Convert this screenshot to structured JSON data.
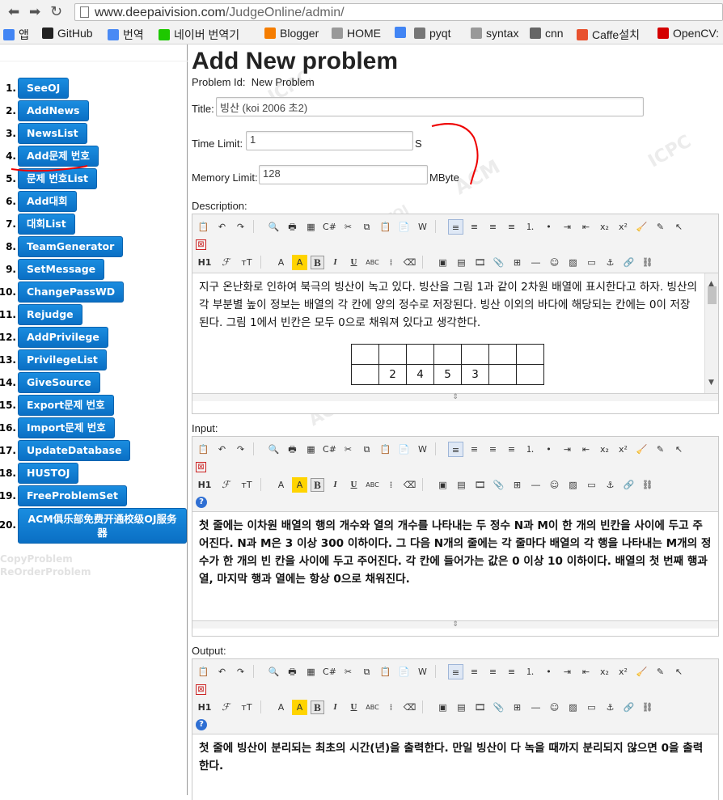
{
  "browser": {
    "url_host": "www.deepaivision.com",
    "url_path": "/JudgeOnline/admin/",
    "bookmarks": [
      {
        "label": "앱",
        "icon": "apps-grid-icon",
        "color": "#4285f4"
      },
      {
        "label": "GitHub",
        "icon": "github-icon",
        "color": "#222222"
      },
      {
        "label": "번역",
        "icon": "translate-icon",
        "color": "#4a8af4"
      },
      {
        "label": "네이버 번역기",
        "icon": "naver-icon",
        "color": "#1ec800"
      },
      {
        "label": "Blogger",
        "icon": "blogger-icon",
        "color": "#f57d00"
      },
      {
        "label": "HOME",
        "icon": "page-icon",
        "color": "#999999"
      },
      {
        "label": "",
        "icon": "google-icon",
        "color": "#4285f4"
      },
      {
        "label": "pyqt",
        "icon": "wiki-icon",
        "color": "#777777"
      },
      {
        "label": "syntax",
        "icon": "page-icon",
        "color": "#999999"
      },
      {
        "label": "cnn",
        "icon": "cnn-icon",
        "color": "#666666"
      },
      {
        "label": "Caffe설치",
        "icon": "caffe-icon",
        "color": "#e8522f"
      },
      {
        "label": "OpenCV:",
        "icon": "opencv-icon",
        "color": "#d40000"
      }
    ]
  },
  "sidebar": {
    "items": [
      {
        "num": "1.",
        "label": "SeeOJ"
      },
      {
        "num": "2.",
        "label": "AddNews"
      },
      {
        "num": "3.",
        "label": "NewsList"
      },
      {
        "num": "4.",
        "label": "Add문제 번호"
      },
      {
        "num": "5.",
        "label": "문제 번호List"
      },
      {
        "num": "6.",
        "label": "Add대회"
      },
      {
        "num": "7.",
        "label": "대회List"
      },
      {
        "num": "8.",
        "label": "TeamGenerator"
      },
      {
        "num": "9.",
        "label": "SetMessage"
      },
      {
        "num": "10.",
        "label": "ChangePassWD"
      },
      {
        "num": "11.",
        "label": "Rejudge"
      },
      {
        "num": "12.",
        "label": "AddPrivilege"
      },
      {
        "num": "13.",
        "label": "PrivilegeList"
      },
      {
        "num": "14.",
        "label": "GiveSource"
      },
      {
        "num": "15.",
        "label": "Export문제 번호"
      },
      {
        "num": "16.",
        "label": "Import문제 번호"
      },
      {
        "num": "17.",
        "label": "UpdateDatabase"
      },
      {
        "num": "18.",
        "label": "HUSTOJ"
      },
      {
        "num": "19.",
        "label": "FreeProblemSet"
      },
      {
        "num": "20.",
        "label": "ACM俱乐部免费开通校级OJ服务器"
      }
    ],
    "faint_links": [
      "CopyProblem",
      "ReOrderProblem"
    ]
  },
  "watermark": {
    "words": [
      "ACM",
      "ICPC",
      "HUSTOJ"
    ]
  },
  "main": {
    "title": "Add New problem",
    "problem_id_label": "Problem Id:",
    "problem_id_value": "New Problem",
    "title_label": "Title:",
    "title_value": "빙산 (koi 2006 초2)",
    "time_limit_label": "Time Limit:",
    "time_limit_value": "1",
    "time_unit": "S",
    "memory_limit_label": "Memory Limit:",
    "memory_limit_value": "128",
    "memory_unit": "MByte",
    "description_label": "Description:",
    "description_text": "지구 온난화로 인하여 북극의 빙산이 녹고 있다. 빙산을 그림 1과 같이 2차원 배열에 표시한다고 하자. 빙산의 각 부분별 높이 정보는 배열의 각 칸에 양의 정수로 저장된다. 빙산 이외의 바다에 해당되는 칸에는 0이 저장된다. 그림 1에서 빈칸은 모두 0으로 채워져 있다고 생각한다.",
    "grid_row1": [
      "",
      "",
      "",
      "",
      "",
      "",
      ""
    ],
    "grid_row2": [
      "",
      "2",
      "4",
      "5",
      "3",
      "",
      ""
    ],
    "input_label": "Input:",
    "input_text": "첫 줄에는 이차원 배열의 행의 개수와 열의 개수를 나타내는 두 정수 N과 M이 한 개의 빈칸을 사이에 두고 주어진다. N과 M은 3 이상 300 이하이다. 그 다음 N개의 줄에는 각 줄마다 배열의 각 행을 나타내는 M개의 정수가 한 개의 빈 칸을 사이에 두고 주어진다. 각 칸에 들어가는 값은 0 이상 10 이하이다. 배열의 첫 번째 행과 열, 마지막 행과 열에는 항상 0으로 채워진다.",
    "output_label": "Output:",
    "output_text": "첫 줄에 빙산이 분리되는 최초의 시간(년)을 출력한다. 만일 빙산이 다 녹을 때까지 분리되지 않으면 0을 출력한다."
  },
  "toolbar": {
    "headings": "H1",
    "font_name": "ℱ",
    "font_size": "тT",
    "bold": "B",
    "italic": "I",
    "underline": "U",
    "strike": "ABC",
    "help": "?"
  }
}
